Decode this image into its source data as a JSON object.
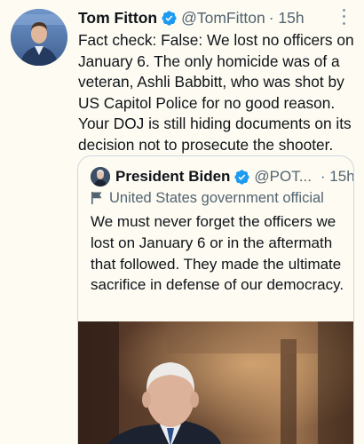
{
  "tweet": {
    "author_name": "Tom Fitton",
    "handle": "@TomFitton",
    "time": "· 15h",
    "text": "Fact check: False: We lost no officers on January 6.  The only homicide was of a veteran, Ashli Babbitt, who was shot by US Capitol Police for no good reason. Your DOJ is still hiding documents on its decision not to prosecute the shooter.",
    "verified": true
  },
  "quoted": {
    "author_name": "President Biden",
    "handle": "@POT...",
    "time": "· 15h",
    "label": "United States government official",
    "text": "We must never forget the officers we lost on January 6 or in the aftermath that followed. They made the ultimate sacrifice in defense of our democracy.",
    "verified": true
  },
  "colors": {
    "verified_blue": "#1d9bf0",
    "secondary_text": "#536471",
    "background": "#fdfbf2"
  },
  "icons": {
    "verified": "verified-badge-icon",
    "more": "more-options-icon",
    "label": "government-flag-icon"
  }
}
